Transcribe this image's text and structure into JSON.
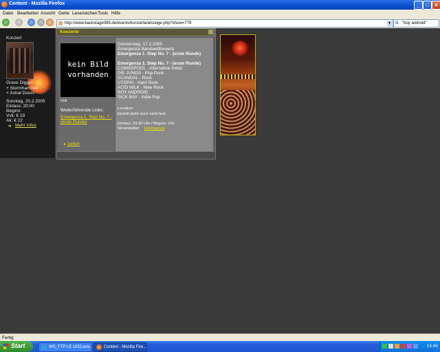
{
  "window": {
    "title": "Content - Mozilla Firefox",
    "controls": {
      "minimize": "_",
      "maximize": "□",
      "close": "×"
    }
  },
  "menubar": {
    "items": [
      "Datei",
      "Bearbeiten",
      "Ansicht",
      "Gehe",
      "Lesezeichen",
      "Tools",
      "Hilfe"
    ]
  },
  "navbar": {
    "url": "http://www.backstage089.de/events/konzerte/anzeige.php?show=779",
    "search_value": "\"boy android\"",
    "search_engine_icon": "G"
  },
  "sidebar": {
    "heading": "Konzert",
    "band": "Grave Digger",
    "support": [
      "+ Stormhammer",
      "+ Astral Doors"
    ],
    "date": "Sonntag, 20.2.2005",
    "einlass": "Einlass: 20:00",
    "beginn": "Beginn:",
    "vvk": "Vvk: € 19",
    "ak": "Ak: € 22",
    "more_info": "Mehr Infos",
    "more_info_arrow": "➜"
  },
  "panel": {
    "header": "Konzerte",
    "no_image_line1": "kein Bild",
    "no_image_line2": "vorhanden",
    "caption": "n/a",
    "links_heading": "Weiterführende Links:",
    "link_line1": "Emergenza 1. Step No. 7 -",
    "link_line2": "(erste Runde)",
    "back_arrow": "◄",
    "back_label": "zurück",
    "date": "Donnerstag, 17.2.2005",
    "subtitle": "Emergenza Bandwettbewerb",
    "title_bold": "Emergenza 1. Step No. 7 - (erste Runde)",
    "lineup_heading": "Emergenza 1. Step No. 7 - (erste Runde)",
    "lineup": [
      "COMASPOOL - Alternative metal",
      "DIE JUNGS - Pop Punk",
      "SCANDAL - Rock",
      "UTOPIA - Hard Rock",
      "ACID MILK - New Rock",
      "BOY ANDROID",
      "SICK BAY - Indie Pop"
    ],
    "location_label": "Location:",
    "location_value": "Eintritt steht noch nicht fest",
    "einlass": "Einlass: 19:30 Uhr / Beginn: Uhr",
    "veranstalter_label": "Veranstalter:",
    "veranstalter_value": "Emergenza"
  },
  "statusbar": {
    "text": "Fertig"
  },
  "taskbar": {
    "start": "Start",
    "tasks": [
      "WS_FTP LE s332.eva...",
      "Content - Mozilla Fire..."
    ],
    "clock": "15:45"
  }
}
